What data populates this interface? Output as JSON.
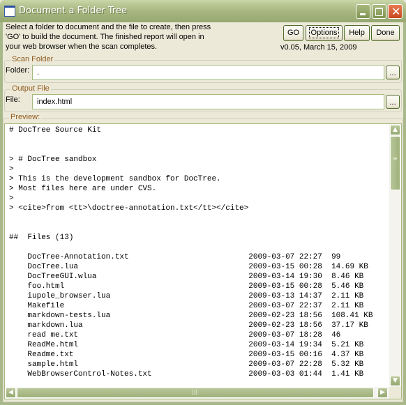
{
  "window": {
    "title": "Document a Folder Tree",
    "icon": "app-window-icon",
    "controls": {
      "minimize": "minimize-icon",
      "maximize": "maximize-icon",
      "close": "close-icon"
    }
  },
  "intro_text": "Select a folder to document and the file to create, then press 'GO' to build the document. The finished report will open in your web browser when the scan completes.",
  "buttons": {
    "go": "GO",
    "options": "Options",
    "help": "Help",
    "done": "Done"
  },
  "version": "v0.05, March 15, 2009",
  "scan_folder": {
    "legend": "Scan Folder",
    "label": "Folder:",
    "value": ".",
    "browse": "..."
  },
  "output_file": {
    "legend": "Output File",
    "label": "File:",
    "value": "index.html",
    "browse": "..."
  },
  "preview": {
    "legend": "Preview:",
    "lines": [
      "# DocTree Source Kit",
      "",
      "",
      "> # DocTree sandbox",
      ">",
      "> This is the development sandbox for DocTree.",
      "> Most files here are under CVS.",
      ">",
      "> <cite>from <tt>\\doctree-annotation.txt</tt></cite>",
      "",
      "",
      "##  Files (13)",
      "",
      "    DocTree-Annotation.txt                          2009-03-07 22:27  99",
      "    DocTree.lua                                     2009-03-15 00:28  14.69 KB",
      "    DocTreeGUI.wlua                                 2009-03-14 19:30  8.46 KB",
      "    foo.html                                        2009-03-15 00:28  5.46 KB",
      "    iupole_browser.lua                              2009-03-13 14:37  2.11 KB",
      "    Makefile                                        2009-03-07 22:37  2.11 KB",
      "    markdown-tests.lua                              2009-02-23 18:56  108.41 KB",
      "    markdown.lua                                    2009-02-23 18:56  37.17 KB",
      "    read me.txt                                     2009-03-07 18:28  46",
      "    ReadMe.html                                     2009-03-14 19:34  5.21 KB",
      "    Readme.txt                                      2009-03-15 00:16  4.37 KB",
      "    sample.html                                     2009-03-07 22:28  5.32 KB",
      "    WebBrowserControl-Notes.txt                     2009-03-03 01:44  1.41 KB"
    ]
  },
  "scrollbars": {
    "up": "scroll-up-icon",
    "down": "scroll-down-icon",
    "left": "scroll-left-icon",
    "right": "scroll-right-icon"
  }
}
